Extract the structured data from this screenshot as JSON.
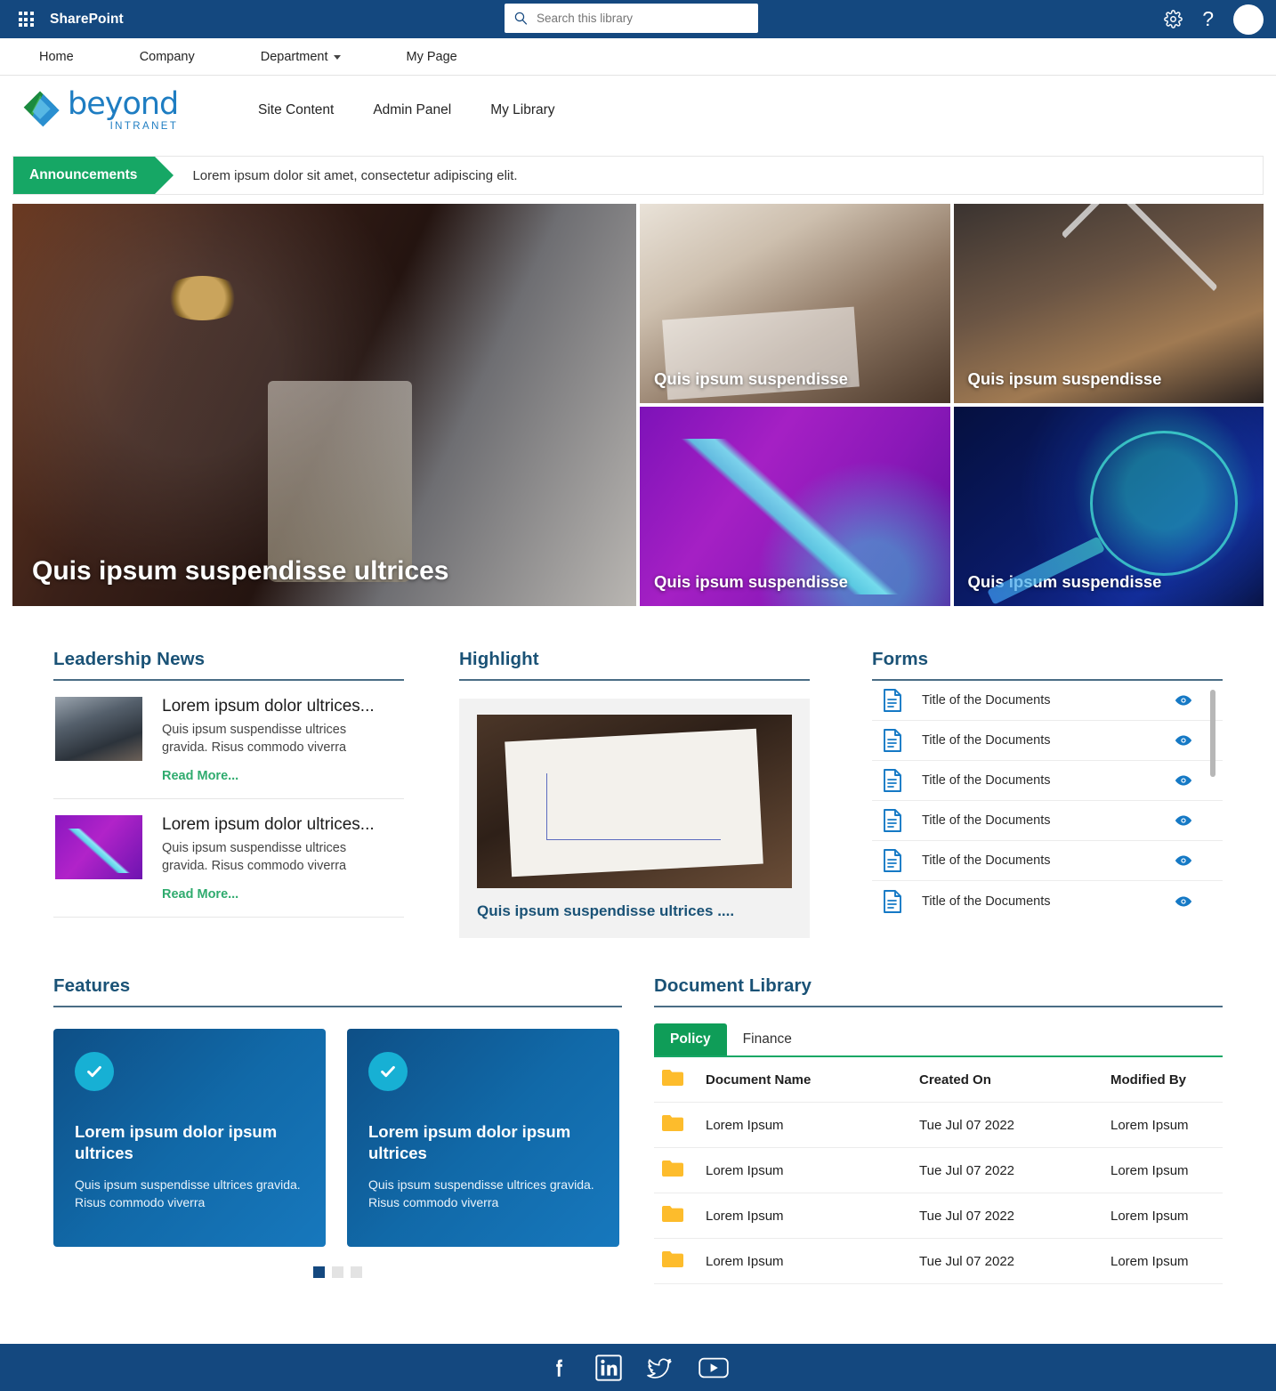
{
  "suitebar": {
    "app_launcher_icon": "waffle-grid-icon",
    "title": "SharePoint",
    "search_placeholder": "Search this library",
    "search_value": "",
    "search_icon": "search-icon",
    "settings_icon": "gear-icon",
    "help_icon": "question-mark-icon",
    "avatar_icon": "user-avatar"
  },
  "topnav": {
    "items": [
      {
        "label": "Home",
        "has_chevron": false
      },
      {
        "label": "Company",
        "has_chevron": false
      },
      {
        "label": "Department",
        "has_chevron": true
      },
      {
        "label": "My Page",
        "has_chevron": false
      }
    ]
  },
  "brand": {
    "logo_word": "beyond",
    "logo_sub": "INTRANET",
    "nav": [
      {
        "label": "Site Content"
      },
      {
        "label": "Admin Panel"
      },
      {
        "label": "My Library"
      }
    ]
  },
  "announcements": {
    "tag": "Announcements",
    "text": "Lorem ipsum dolor sit amet, consectetur adipiscing elit."
  },
  "hero": {
    "main": {
      "caption": "Quis ipsum suspendisse ultrices",
      "image": "hand-dropping-coin-into-jar"
    },
    "tiles": [
      {
        "caption": "Quis ipsum suspendisse",
        "image": "hands-with-calculator-and-paperwork"
      },
      {
        "caption": "Quis ipsum suspendisse",
        "image": "insurance-wooden-blocks-family"
      },
      {
        "caption": "Quis ipsum suspendisse",
        "image": "purple-growth-arrow-chart"
      },
      {
        "caption": "Quis ipsum suspendisse",
        "image": "blue-network-magnifier"
      }
    ]
  },
  "leadership_news": {
    "title": "Leadership News",
    "items": [
      {
        "heading": "Lorem ipsum dolor ultrices...",
        "body": "Quis ipsum suspendisse ultrices gravida. Risus commodo viverra",
        "link": "Read More...",
        "thumb": "business-meeting-photo"
      },
      {
        "heading": "Lorem ipsum dolor ultrices...",
        "body": "Quis ipsum suspendisse ultrices gravida. Risus commodo viverra",
        "link": "Read More...",
        "thumb": "purple-growth-arrow-chart"
      }
    ]
  },
  "highlight": {
    "title": "Highlight",
    "image": "notebook-with-line-graph-and-pens",
    "caption": "Quis ipsum suspendisse ultrices ...."
  },
  "forms": {
    "title": "Forms",
    "doc_icon": "document-icon",
    "view_icon": "eye-icon",
    "items": [
      {
        "name": "Title of the Documents"
      },
      {
        "name": "Title of the Documents"
      },
      {
        "name": "Title of the Documents"
      },
      {
        "name": "Title of the Documents"
      },
      {
        "name": "Title of the Documents"
      },
      {
        "name": "Title of the Documents"
      }
    ]
  },
  "features": {
    "title": "Features",
    "check_icon": "check-circle-icon",
    "cards": [
      {
        "heading": "Lorem ipsum dolor ipsum ultrices",
        "body": "Quis ipsum suspendisse ultrices gravida. Risus commodo viverra"
      },
      {
        "heading": "Lorem ipsum dolor ipsum ultrices",
        "body": "Quis ipsum suspendisse ultrices gravida. Risus commodo viverra"
      }
    ],
    "carousel": {
      "total": 3,
      "active_index": 0
    }
  },
  "document_library": {
    "title": "Document Library",
    "tabs": [
      {
        "label": "Policy",
        "active": true
      },
      {
        "label": "Finance",
        "active": false
      }
    ],
    "folder_icon": "folder-icon",
    "columns": [
      "Document Name",
      "Created On",
      "Modified By"
    ],
    "rows": [
      {
        "name": "Lorem Ipsum",
        "created_on": "Tue Jul 07 2022",
        "modified_by": "Lorem Ipsum"
      },
      {
        "name": "Lorem Ipsum",
        "created_on": "Tue Jul 07 2022",
        "modified_by": "Lorem Ipsum"
      },
      {
        "name": "Lorem Ipsum",
        "created_on": "Tue Jul 07 2022",
        "modified_by": "Lorem Ipsum"
      },
      {
        "name": "Lorem Ipsum",
        "created_on": "Tue Jul 07 2022",
        "modified_by": "Lorem Ipsum"
      }
    ]
  },
  "footer": {
    "social": [
      {
        "icon": "facebook-icon",
        "label": "Facebook"
      },
      {
        "icon": "linkedin-icon",
        "label": "LinkedIn"
      },
      {
        "icon": "twitter-icon",
        "label": "Twitter"
      },
      {
        "icon": "youtube-icon",
        "label": "YouTube"
      }
    ]
  },
  "colors": {
    "suitebar_blue": "#14487f",
    "brand_blue": "#1e7dc2",
    "announce_green": "#16a765",
    "tab_green": "#0f9d58",
    "readmore_green": "#2fab6e",
    "heading_blue": "#1a5276",
    "date_link_blue": "#3d8fd6",
    "folder_yellow": "#fdbc2c",
    "doc_icon_blue": "#1579c5",
    "check_cyan": "#17b0d4"
  }
}
